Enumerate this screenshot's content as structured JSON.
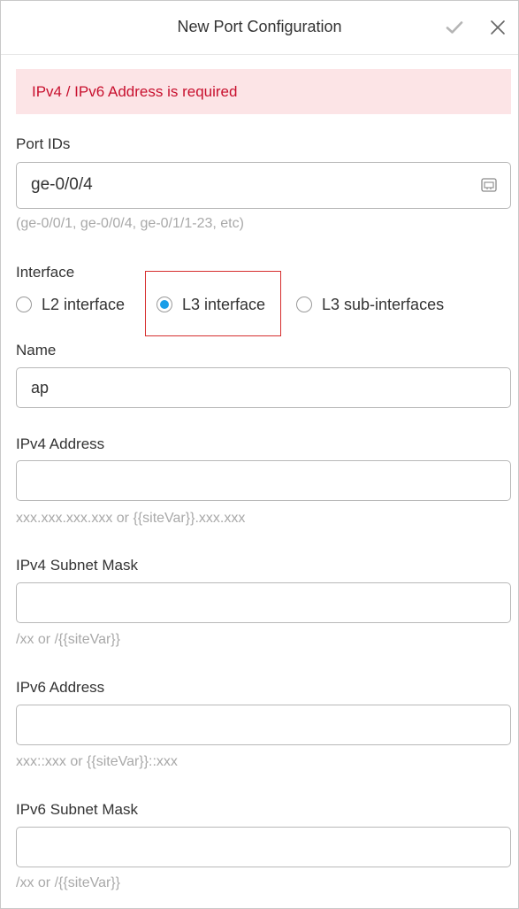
{
  "header": {
    "title": "New Port Configuration",
    "icons": {
      "confirm": "check-icon",
      "close": "close-icon"
    }
  },
  "alert": {
    "message": "IPv4 / IPv6 Address is required"
  },
  "port_ids": {
    "label": "Port IDs",
    "value": "ge-0/0/4",
    "hint": "(ge-0/0/1, ge-0/0/4, ge-0/1/1-23, etc)",
    "icon": "port-picker-icon"
  },
  "interface": {
    "label": "Interface",
    "options": [
      {
        "label": "L2 interface",
        "selected": false
      },
      {
        "label": "L3 interface",
        "selected": true
      },
      {
        "label": "L3 sub-interfaces",
        "selected": false
      }
    ]
  },
  "name": {
    "label": "Name",
    "value": "ap"
  },
  "ipv4_address": {
    "label": "IPv4 Address",
    "value": "",
    "hint": "xxx.xxx.xxx.xxx or {{siteVar}}.xxx.xxx"
  },
  "ipv4_subnet": {
    "label": "IPv4 Subnet Mask",
    "value": "",
    "hint": "/xx or /{{siteVar}}"
  },
  "ipv6_address": {
    "label": "IPv6 Address",
    "value": "",
    "hint": "xxx::xxx or {{siteVar}}::xxx"
  },
  "ipv6_subnet": {
    "label": "IPv6 Subnet Mask",
    "value": "",
    "hint": "/xx or /{{siteVar}}"
  },
  "colors": {
    "accent": "#1a9ee8",
    "error_text": "#c8102e",
    "error_bg": "#fce4e6",
    "highlight": "#d62e2e"
  }
}
